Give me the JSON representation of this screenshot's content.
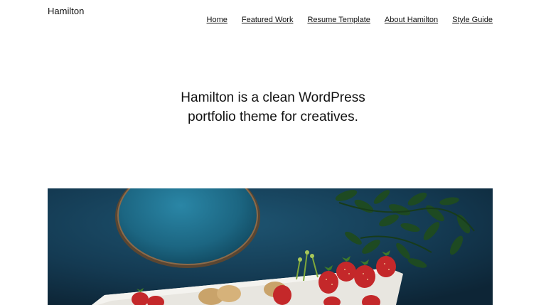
{
  "site": {
    "title": "Hamilton"
  },
  "nav": {
    "items": [
      {
        "label": "Home"
      },
      {
        "label": "Featured Work"
      },
      {
        "label": "Resume Template"
      },
      {
        "label": "About Hamilton"
      },
      {
        "label": "Style Guide"
      }
    ]
  },
  "hero": {
    "tagline": "Hamilton is a clean WordPress portfolio theme for creatives."
  },
  "featured_image": {
    "subject": "blue-table-plate-strawberries",
    "colors": {
      "table": "#143a52",
      "plate": "#1f6a86",
      "plate_rim": "#8b6a4a",
      "leaves": "#1e4a22",
      "strawberry": "#c4282a",
      "board": "#e8e6e0"
    }
  }
}
